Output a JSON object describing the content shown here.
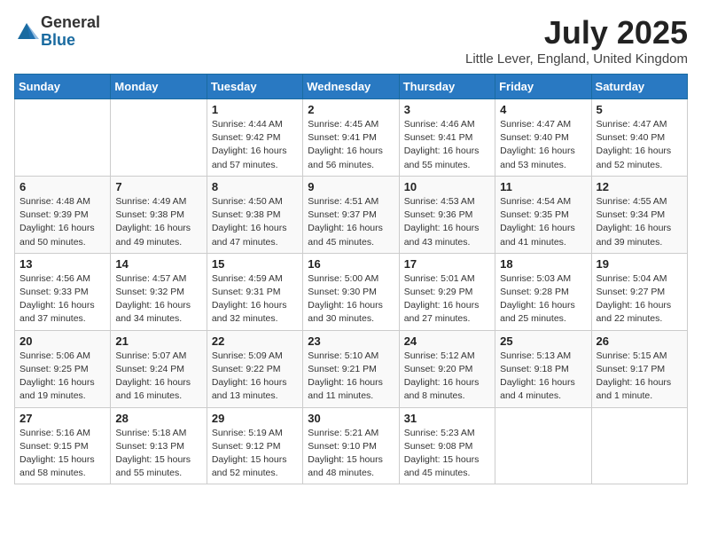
{
  "logo": {
    "general": "General",
    "blue": "Blue"
  },
  "title": "July 2025",
  "location": "Little Lever, England, United Kingdom",
  "weekdays": [
    "Sunday",
    "Monday",
    "Tuesday",
    "Wednesday",
    "Thursday",
    "Friday",
    "Saturday"
  ],
  "weeks": [
    [
      {
        "day": "",
        "detail": ""
      },
      {
        "day": "",
        "detail": ""
      },
      {
        "day": "1",
        "detail": "Sunrise: 4:44 AM\nSunset: 9:42 PM\nDaylight: 16 hours and 57 minutes."
      },
      {
        "day": "2",
        "detail": "Sunrise: 4:45 AM\nSunset: 9:41 PM\nDaylight: 16 hours and 56 minutes."
      },
      {
        "day": "3",
        "detail": "Sunrise: 4:46 AM\nSunset: 9:41 PM\nDaylight: 16 hours and 55 minutes."
      },
      {
        "day": "4",
        "detail": "Sunrise: 4:47 AM\nSunset: 9:40 PM\nDaylight: 16 hours and 53 minutes."
      },
      {
        "day": "5",
        "detail": "Sunrise: 4:47 AM\nSunset: 9:40 PM\nDaylight: 16 hours and 52 minutes."
      }
    ],
    [
      {
        "day": "6",
        "detail": "Sunrise: 4:48 AM\nSunset: 9:39 PM\nDaylight: 16 hours and 50 minutes."
      },
      {
        "day": "7",
        "detail": "Sunrise: 4:49 AM\nSunset: 9:38 PM\nDaylight: 16 hours and 49 minutes."
      },
      {
        "day": "8",
        "detail": "Sunrise: 4:50 AM\nSunset: 9:38 PM\nDaylight: 16 hours and 47 minutes."
      },
      {
        "day": "9",
        "detail": "Sunrise: 4:51 AM\nSunset: 9:37 PM\nDaylight: 16 hours and 45 minutes."
      },
      {
        "day": "10",
        "detail": "Sunrise: 4:53 AM\nSunset: 9:36 PM\nDaylight: 16 hours and 43 minutes."
      },
      {
        "day": "11",
        "detail": "Sunrise: 4:54 AM\nSunset: 9:35 PM\nDaylight: 16 hours and 41 minutes."
      },
      {
        "day": "12",
        "detail": "Sunrise: 4:55 AM\nSunset: 9:34 PM\nDaylight: 16 hours and 39 minutes."
      }
    ],
    [
      {
        "day": "13",
        "detail": "Sunrise: 4:56 AM\nSunset: 9:33 PM\nDaylight: 16 hours and 37 minutes."
      },
      {
        "day": "14",
        "detail": "Sunrise: 4:57 AM\nSunset: 9:32 PM\nDaylight: 16 hours and 34 minutes."
      },
      {
        "day": "15",
        "detail": "Sunrise: 4:59 AM\nSunset: 9:31 PM\nDaylight: 16 hours and 32 minutes."
      },
      {
        "day": "16",
        "detail": "Sunrise: 5:00 AM\nSunset: 9:30 PM\nDaylight: 16 hours and 30 minutes."
      },
      {
        "day": "17",
        "detail": "Sunrise: 5:01 AM\nSunset: 9:29 PM\nDaylight: 16 hours and 27 minutes."
      },
      {
        "day": "18",
        "detail": "Sunrise: 5:03 AM\nSunset: 9:28 PM\nDaylight: 16 hours and 25 minutes."
      },
      {
        "day": "19",
        "detail": "Sunrise: 5:04 AM\nSunset: 9:27 PM\nDaylight: 16 hours and 22 minutes."
      }
    ],
    [
      {
        "day": "20",
        "detail": "Sunrise: 5:06 AM\nSunset: 9:25 PM\nDaylight: 16 hours and 19 minutes."
      },
      {
        "day": "21",
        "detail": "Sunrise: 5:07 AM\nSunset: 9:24 PM\nDaylight: 16 hours and 16 minutes."
      },
      {
        "day": "22",
        "detail": "Sunrise: 5:09 AM\nSunset: 9:22 PM\nDaylight: 16 hours and 13 minutes."
      },
      {
        "day": "23",
        "detail": "Sunrise: 5:10 AM\nSunset: 9:21 PM\nDaylight: 16 hours and 11 minutes."
      },
      {
        "day": "24",
        "detail": "Sunrise: 5:12 AM\nSunset: 9:20 PM\nDaylight: 16 hours and 8 minutes."
      },
      {
        "day": "25",
        "detail": "Sunrise: 5:13 AM\nSunset: 9:18 PM\nDaylight: 16 hours and 4 minutes."
      },
      {
        "day": "26",
        "detail": "Sunrise: 5:15 AM\nSunset: 9:17 PM\nDaylight: 16 hours and 1 minute."
      }
    ],
    [
      {
        "day": "27",
        "detail": "Sunrise: 5:16 AM\nSunset: 9:15 PM\nDaylight: 15 hours and 58 minutes."
      },
      {
        "day": "28",
        "detail": "Sunrise: 5:18 AM\nSunset: 9:13 PM\nDaylight: 15 hours and 55 minutes."
      },
      {
        "day": "29",
        "detail": "Sunrise: 5:19 AM\nSunset: 9:12 PM\nDaylight: 15 hours and 52 minutes."
      },
      {
        "day": "30",
        "detail": "Sunrise: 5:21 AM\nSunset: 9:10 PM\nDaylight: 15 hours and 48 minutes."
      },
      {
        "day": "31",
        "detail": "Sunrise: 5:23 AM\nSunset: 9:08 PM\nDaylight: 15 hours and 45 minutes."
      },
      {
        "day": "",
        "detail": ""
      },
      {
        "day": "",
        "detail": ""
      }
    ]
  ]
}
